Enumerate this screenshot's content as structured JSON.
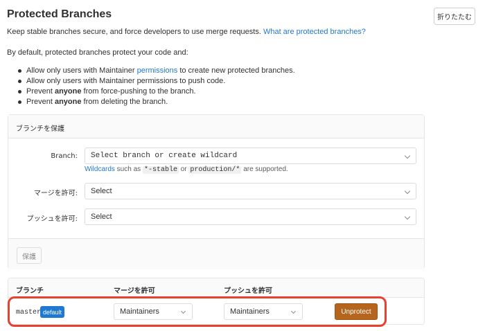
{
  "header": {
    "title": "Protected Branches",
    "collapse_label": "折りたたむ",
    "subtitle_text": "Keep stable branches secure, and force developers to use merge requests.",
    "subtitle_link": "What are protected branches?",
    "intro": "By default, protected branches protect your code and:"
  },
  "rules": [
    {
      "before": "Allow only users with Maintainer ",
      "link": "permissions",
      "after": " to create new protected branches."
    },
    {
      "text": "Allow only users with Maintainer permissions to push code."
    },
    {
      "before": "Prevent ",
      "bold": "anyone",
      "after": " from force-pushing to the branch."
    },
    {
      "before": "Prevent ",
      "bold": "anyone",
      "after": " from deleting the branch."
    }
  ],
  "form": {
    "header": "ブランチを保護",
    "branch_label": "Branch:",
    "branch_placeholder": "Select branch or create wildcard",
    "hint_link": "Wildcards",
    "hint_text1": " such as ",
    "hint_code1": "*-stable",
    "hint_text2": " or ",
    "hint_code2": "production/*",
    "hint_text3": " are supported.",
    "merge_label": "マージを許可:",
    "merge_value": "Select",
    "push_label": "プッシュを許可:",
    "push_value": "Select",
    "protect_button": "保護"
  },
  "table": {
    "headers": [
      "ブランチ",
      "マージを許可",
      "プッシュを許可"
    ],
    "rows": [
      {
        "branch": "master",
        "badge": "default",
        "merge": "Maintainers",
        "push": "Maintainers",
        "action": "Unprotect"
      }
    ]
  },
  "colors": {
    "link": "#1f78d1",
    "badge": "#1f78d1",
    "unprotect": "#b5651d",
    "highlight": "#e8402f"
  }
}
